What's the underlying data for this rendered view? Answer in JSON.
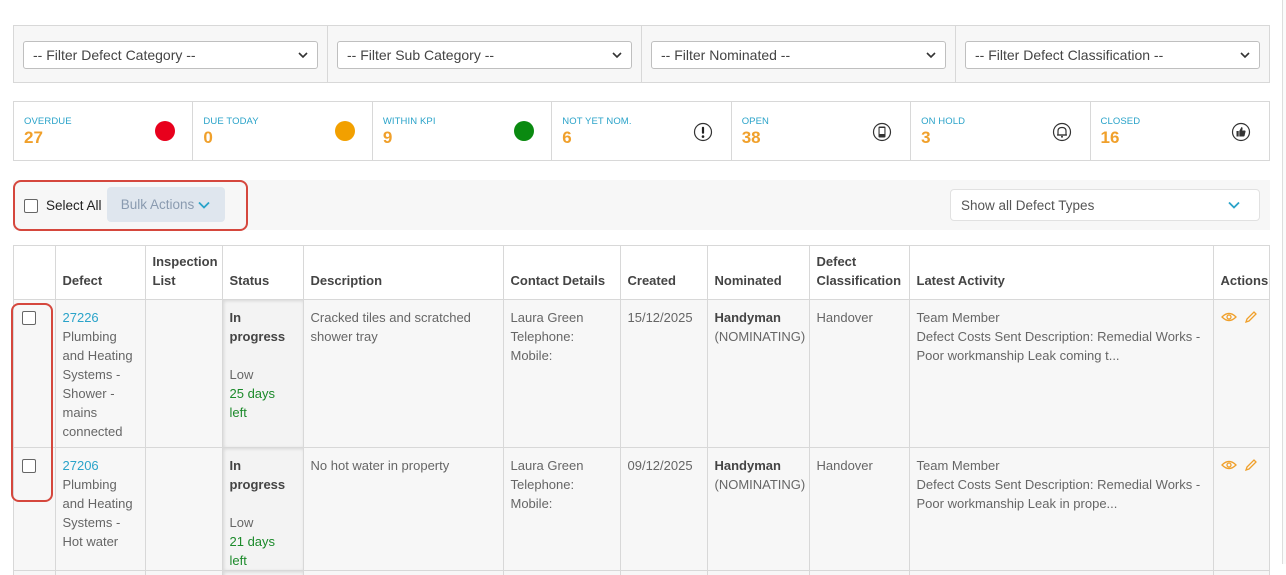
{
  "filters": [
    {
      "label": "-- Filter Defect Category --"
    },
    {
      "label": "-- Filter Sub Category --"
    },
    {
      "label": "-- Filter Nominated --"
    },
    {
      "label": "-- Filter Defect Classification --"
    }
  ],
  "stats": [
    {
      "label": "OVERDUE",
      "value": "27",
      "icon": "red-dot-icon",
      "color": "#e8001c"
    },
    {
      "label": "DUE TODAY",
      "value": "0",
      "icon": "orange-dot-icon",
      "color": "#f2a000"
    },
    {
      "label": "WITHIN KPI",
      "value": "9",
      "icon": "green-dot-icon",
      "color": "#0a8a10"
    },
    {
      "label": "NOT YET NOM.",
      "value": "6",
      "icon": "exclamation-icon"
    },
    {
      "label": "OPEN",
      "value": "38",
      "icon": "phone-icon"
    },
    {
      "label": "ON HOLD",
      "value": "3",
      "icon": "bell-icon"
    },
    {
      "label": "CLOSED",
      "value": "16",
      "icon": "thumbs-up-icon"
    }
  ],
  "toolbar": {
    "select_all": "Select All",
    "bulk_actions": "Bulk Actions",
    "defect_types": "Show all Defect Types"
  },
  "table": {
    "headers": {
      "defect": "Defect",
      "inspection_list": "Inspection List",
      "status": "Status",
      "description": "Description",
      "contact": "Contact Details",
      "created": "Created",
      "nominated": "Nominated",
      "classification": "Defect Classification",
      "activity": "Latest Activity",
      "actions": "Actions"
    },
    "rows": [
      {
        "id": "27226",
        "category": "Plumbing and Heating Systems - Shower - mains connected",
        "inspection_list": "",
        "status": "In progress",
        "priority": "Low",
        "days_left": "25 days left",
        "description": "Cracked tiles and scratched shower tray",
        "contact_name": "Laura Green",
        "telephone": "Telephone:",
        "mobile": "Mobile:",
        "created": "15/12/2025",
        "nominated": "Handyman",
        "nominated_status": "(NOMINATING)",
        "classification": "Handover",
        "activity_user": "Team Member",
        "activity_text": "Defect Costs Sent Description: Remedial Works - Poor workmanship Leak coming t..."
      },
      {
        "id": "27206",
        "category": "Plumbing and Heating Systems - Hot water",
        "inspection_list": "",
        "status": "In progress",
        "priority": "Low",
        "days_left": "21 days left",
        "description": "No hot water in property",
        "contact_name": "Laura Green",
        "telephone": "Telephone:",
        "mobile": "Mobile:",
        "created": "09/12/2025",
        "nominated": "Handyman",
        "nominated_status": "(NOMINATING)",
        "classification": "Handover",
        "activity_user": "Team Member",
        "activity_text": "Defect Costs Sent Description: Remedial Works - Poor workmanship Leak in prope..."
      }
    ]
  },
  "colors": {
    "accent": "#2aa3c9",
    "stat_value": "#f0a02b",
    "highlight": "#d5473d",
    "success": "#1b8a2a"
  }
}
